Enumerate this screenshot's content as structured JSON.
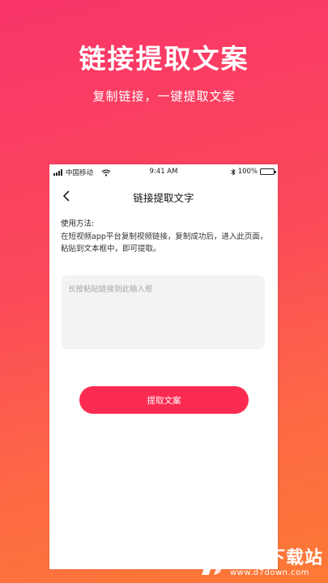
{
  "hero": {
    "title": "链接提取文案",
    "subtitle": "复制链接，一键提取文案"
  },
  "status_bar": {
    "carrier": "中国移动",
    "time": "9:41 AM",
    "battery": "100%",
    "icons": [
      "signal-icon",
      "wifi-icon",
      "bluetooth-icon",
      "battery-icon"
    ]
  },
  "nav": {
    "back_icon": "chevron-left-icon",
    "title": "链接提取文字"
  },
  "instructions": {
    "label": "使用方法:",
    "text": "在短视频app平台复制视频链接，复制成功后，进入此页面，粘贴到文本框中，即可提取。"
  },
  "input": {
    "placeholder": "长按粘贴链接到此输入框",
    "value": ""
  },
  "actions": {
    "extract_label": "提取文案"
  },
  "watermark": {
    "name": "第七下载站",
    "url": "www.d7down.com"
  },
  "colors": {
    "background_top": "#f9346a",
    "background_bottom": "#fd7a35",
    "accent": "#fb2a50",
    "input_bg": "#f3f3f3"
  }
}
